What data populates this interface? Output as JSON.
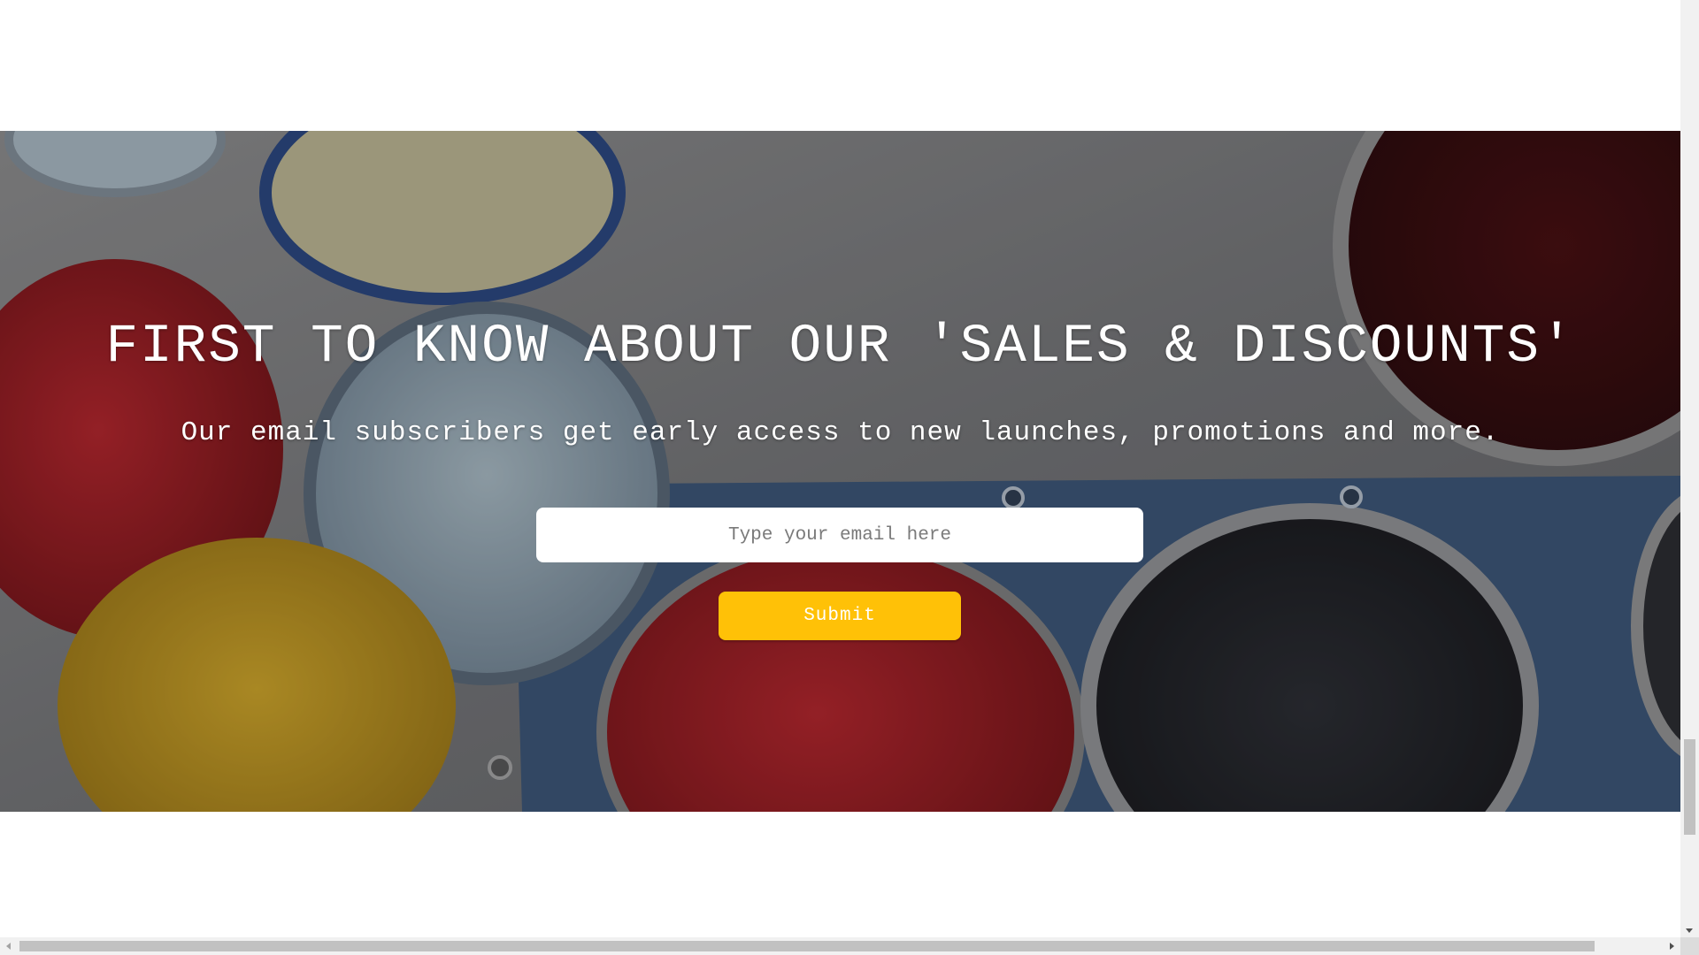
{
  "newsletter": {
    "headline": "FIRST TO KNOW ABOUT OUR 'SALES & DISCOUNTS'",
    "subline": "Our email subscribers get early access to new launches, promotions and more.",
    "email_placeholder": "Type your email here",
    "email_value": "",
    "submit_label": "Submit",
    "background_image": "paint-cans-image",
    "accent_color": "#ffc107"
  }
}
